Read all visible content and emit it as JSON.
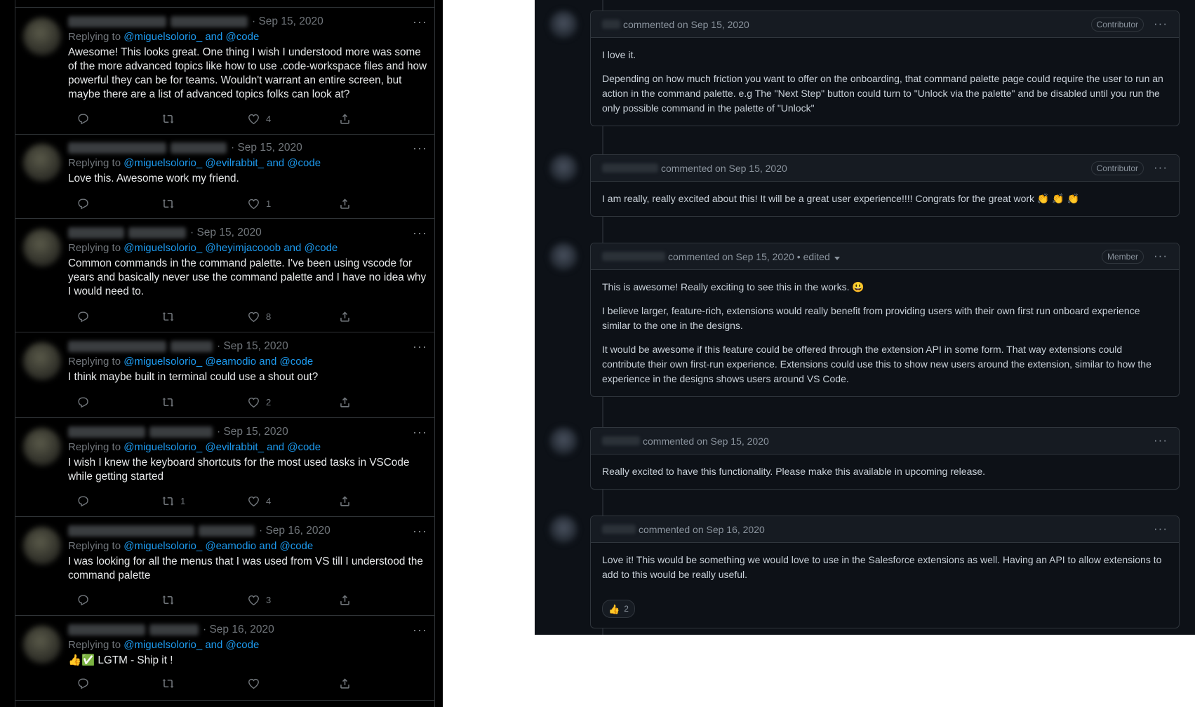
{
  "twitter": {
    "replying_label": "Replying to",
    "tweets": [
      {
        "date": "· Sep 15, 2020",
        "mentions": [
          "@miguelsolorio_",
          "and @code"
        ],
        "text": "Awesome! This looks great. One thing I wish I understood more was some of the more advanced topics like how to use .code-workspace files and how powerful they can be for teams. Wouldn't warrant an entire screen, but maybe there are a list of advanced topics folks can look at?",
        "retweets": "",
        "likes": "4"
      },
      {
        "date": "· Sep 15, 2020",
        "mentions": [
          "@miguelsolorio_",
          "@evilrabbit_",
          "and @code"
        ],
        "text": "Love this. Awesome work my friend.",
        "retweets": "",
        "likes": "1"
      },
      {
        "date": "· Sep 15, 2020",
        "mentions": [
          "@miguelsolorio_",
          "@heyimjacooob",
          "and @code"
        ],
        "text": "Common commands in the command palette. I've been using vscode for years and basically never use the command palette and I have no idea why I would need to.",
        "retweets": "",
        "likes": "8"
      },
      {
        "date": "· Sep 15, 2020",
        "mentions": [
          "@miguelsolorio_",
          "@eamodio",
          "and @code"
        ],
        "text": "I think maybe built in terminal could use a shout out?",
        "retweets": "",
        "likes": "2"
      },
      {
        "date": "· Sep 15, 2020",
        "mentions": [
          "@miguelsolorio_",
          "@evilrabbit_",
          "and @code"
        ],
        "text": "I wish I knew the keyboard shortcuts for the most used tasks in VSCode while getting started",
        "retweets": "1",
        "likes": "4"
      },
      {
        "date": "· Sep 16, 2020",
        "mentions": [
          "@miguelsolorio_",
          "@eamodio",
          "and @code"
        ],
        "text": "I was looking for all the menus that I was used from VS till I understood the command palette",
        "retweets": "",
        "likes": "3"
      },
      {
        "date": "· Sep 16, 2020",
        "mentions": [
          "@miguelsolorio_",
          "and @code"
        ],
        "text": "👍✅ LGTM - Ship it !",
        "retweets": "",
        "likes": ""
      }
    ]
  },
  "github": {
    "comments": [
      {
        "meta": "commented on Sep 15, 2020",
        "edited": "",
        "badge": "Contributor",
        "paragraphs": [
          "I love it.",
          "Depending on how much friction you want to offer on the onboarding, that command palette page could require the user to run an action in the command palette. e.g The \"Next Step\" button could turn to \"Unlock via the palette\" and be disabled until you run the only possible command in the palette of \"Unlock\""
        ]
      },
      {
        "meta": "commented on Sep 15, 2020",
        "edited": "",
        "badge": "Contributor",
        "paragraphs": [
          "I am really, really excited about this! It will be a great user experience!!!! Congrats for the great work 👏 👏 👏"
        ]
      },
      {
        "meta": "commented on Sep 15, 2020",
        "edited": "• edited",
        "badge": "Member",
        "paragraphs": [
          "This is awesome! Really exciting to see this in the works. 😃",
          "I believe larger, feature-rich, extensions would really benefit from providing users with their own first run onboard experience similar to the one in the designs.",
          "It would be awesome if this feature could be offered through the extension API in some form. That way extensions could contribute their own first-run experience. Extensions could use this to show new users around the extension, similar to how the experience in the designs shows users around VS Code."
        ]
      },
      {
        "meta": "commented on Sep 15, 2020",
        "edited": "",
        "badge": "",
        "paragraphs": [
          "Really excited to have this functionality. Please make this available in upcoming release."
        ]
      },
      {
        "meta": "commented on Sep 16, 2020",
        "edited": "",
        "badge": "",
        "paragraphs": [
          "Love it! This would be something we would love to use in the Salesforce extensions as well. Having an API to allow extensions to add to this would be really useful."
        ],
        "reaction": {
          "emoji": "👍",
          "count": "2"
        }
      }
    ]
  }
}
